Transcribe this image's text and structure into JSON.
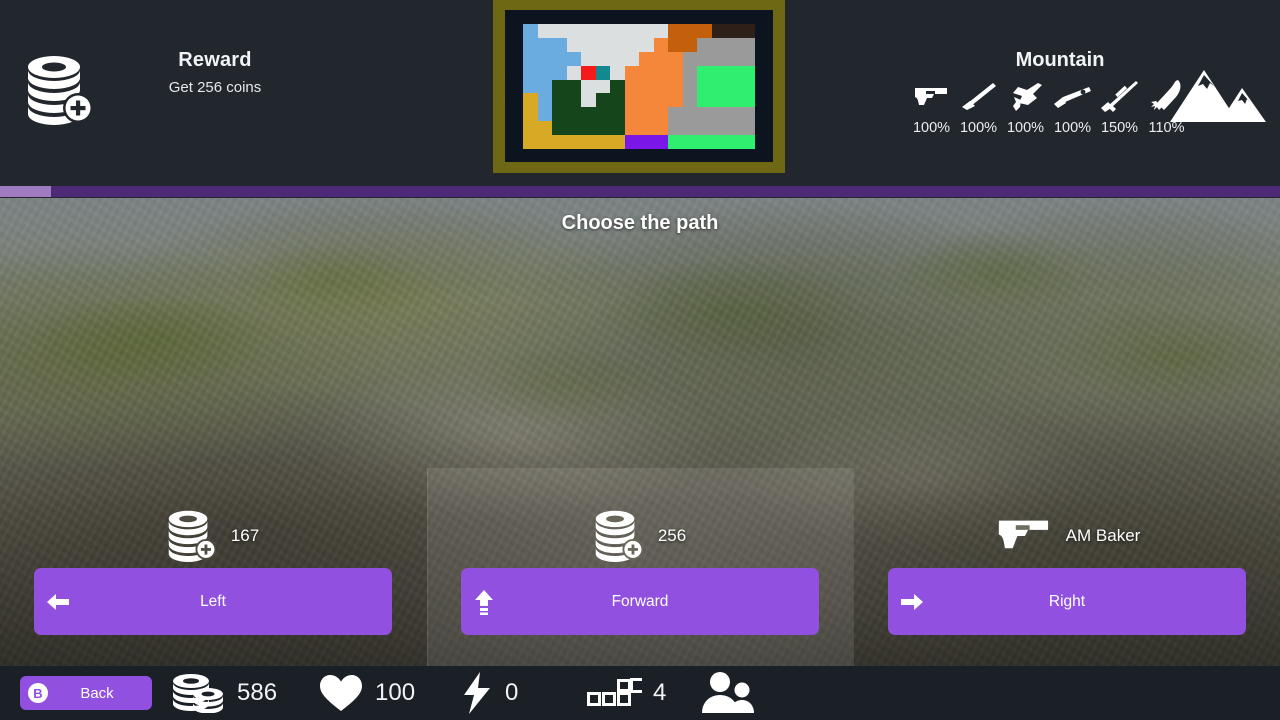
{
  "header": {
    "reward": {
      "icon": "coin-stack-plus-icon",
      "title": "Reward",
      "subtitle": "Get 256 coins"
    },
    "terrain": {
      "title": "Mountain",
      "icon": "mountain-icon",
      "weapons": [
        {
          "icon": "pistol-icon",
          "modifier": "100%"
        },
        {
          "icon": "rifle-icon",
          "modifier": "100%"
        },
        {
          "icon": "smg-icon",
          "modifier": "100%"
        },
        {
          "icon": "shotgun-icon",
          "modifier": "100%"
        },
        {
          "icon": "sniper-icon",
          "modifier": "150%"
        },
        {
          "icon": "rocket-icon",
          "modifier": "110%"
        }
      ]
    },
    "minimap": {
      "name": "territory-minimap",
      "frame_color": "#6e6713",
      "inner_color": "#0c1420",
      "palette": {
        "sky": "#6aabe0",
        "snow": "#dcdfe0",
        "sand": "#d8a925",
        "forest": "#15451a",
        "orange": "#f5873a",
        "brown": "#c4600c",
        "dark": "#2e2018",
        "gray": "#9a9a9a",
        "green": "#2ff06e",
        "purple": "#7b16e8",
        "red": "#f51b1b",
        "teal": "#12898e",
        "void": "#0c1420"
      },
      "rows": [
        [
          "sky",
          "snow",
          "snow",
          "snow",
          "snow",
          "snow",
          "snow",
          "snow",
          "snow",
          "snow",
          "brown",
          "brown",
          "brown",
          "dark",
          "dark",
          "dark"
        ],
        [
          "sky",
          "sky",
          "sky",
          "snow",
          "snow",
          "snow",
          "snow",
          "snow",
          "snow",
          "orange",
          "brown",
          "brown",
          "gray",
          "gray",
          "gray",
          "gray"
        ],
        [
          "sky",
          "sky",
          "sky",
          "sky",
          "snow",
          "snow",
          "snow",
          "snow",
          "orange",
          "orange",
          "orange",
          "gray",
          "gray",
          "gray",
          "gray",
          "gray"
        ],
        [
          "sky",
          "sky",
          "sky",
          "snow",
          "red",
          "teal",
          "snow",
          "orange",
          "orange",
          "orange",
          "orange",
          "gray",
          "green",
          "green",
          "green",
          "green"
        ],
        [
          "sky",
          "sky",
          "forest",
          "forest",
          "snow",
          "snow",
          "forest",
          "orange",
          "orange",
          "orange",
          "orange",
          "gray",
          "green",
          "green",
          "green",
          "green"
        ],
        [
          "sand",
          "sky",
          "forest",
          "forest",
          "snow",
          "forest",
          "forest",
          "orange",
          "orange",
          "orange",
          "orange",
          "gray",
          "green",
          "green",
          "green",
          "green"
        ],
        [
          "sand",
          "sky",
          "forest",
          "forest",
          "forest",
          "forest",
          "forest",
          "orange",
          "orange",
          "orange",
          "gray",
          "gray",
          "gray",
          "gray",
          "gray",
          "gray"
        ],
        [
          "sand",
          "sand",
          "forest",
          "forest",
          "forest",
          "forest",
          "forest",
          "orange",
          "orange",
          "orange",
          "gray",
          "gray",
          "gray",
          "gray",
          "gray",
          "gray"
        ],
        [
          "sand",
          "sand",
          "sand",
          "sand",
          "sand",
          "sand",
          "sand",
          "purple",
          "purple",
          "purple",
          "green",
          "green",
          "green",
          "green",
          "green",
          "green"
        ]
      ]
    }
  },
  "progress": {
    "name": "run-progress-bar",
    "fill_percent": 4,
    "fill_color": "#9f7cc0",
    "track_color": "#4d2a78"
  },
  "stage": {
    "title": "Choose the path",
    "highlighted_column": 1,
    "choices": [
      {
        "direction": "left",
        "arrow_icon": "arrow-left-icon",
        "label": "Left",
        "reward_icon": "coin-stack-plus-icon",
        "reward_value": "167"
      },
      {
        "direction": "forward",
        "arrow_icon": "arrow-up-icon",
        "label": "Forward",
        "reward_icon": "coin-stack-plus-icon",
        "reward_value": "256"
      },
      {
        "direction": "right",
        "arrow_icon": "arrow-right-icon",
        "label": "Right",
        "reward_icon": "pistol-icon",
        "reward_value": "AM Baker"
      }
    ],
    "button_color": "#9150e0"
  },
  "bottombar": {
    "back": {
      "badge": "B",
      "label": "Back",
      "icon": "b-button-icon"
    },
    "stats": [
      {
        "icon": "coins-icon",
        "value": "586"
      },
      {
        "icon": "heart-icon",
        "value": "100"
      },
      {
        "icon": "lightning-icon",
        "value": "0"
      },
      {
        "icon": "blocks-icon",
        "value": "4"
      },
      {
        "icon": "people-icon",
        "value": ""
      }
    ]
  }
}
